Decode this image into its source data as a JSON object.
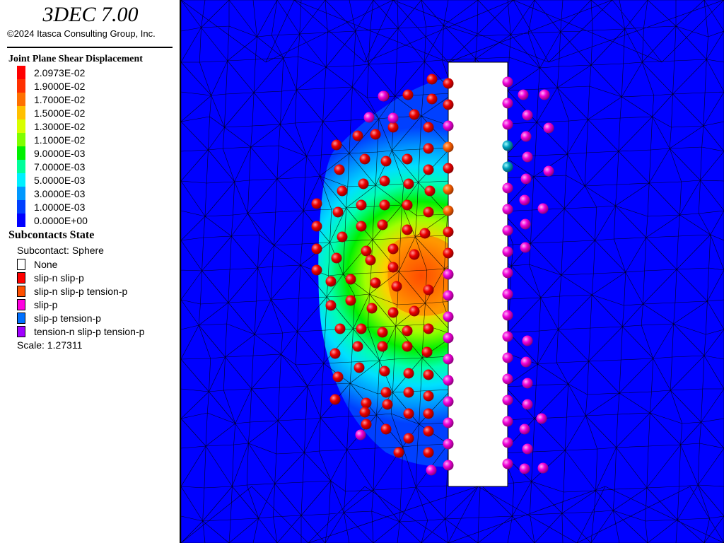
{
  "app": {
    "title": "3DEC 7.00",
    "copyright": "©2024 Itasca Consulting Group, Inc."
  },
  "legend": {
    "shear": {
      "heading": "Joint Plane Shear Displacement",
      "levels": [
        {
          "label": "2.0973E-02",
          "color": "#ff0000"
        },
        {
          "label": "1.9000E-02",
          "color": "#ff3000"
        },
        {
          "label": "1.7000E-02",
          "color": "#ff7000"
        },
        {
          "label": "1.5000E-02",
          "color": "#ffc000"
        },
        {
          "label": "1.3000E-02",
          "color": "#d8ff00"
        },
        {
          "label": "1.1000E-02",
          "color": "#80ff00"
        },
        {
          "label": "9.0000E-03",
          "color": "#00f000"
        },
        {
          "label": "7.0000E-03",
          "color": "#00ff9a"
        },
        {
          "label": "5.0000E-03",
          "color": "#00f0ff"
        },
        {
          "label": "3.0000E-03",
          "color": "#0098ff"
        },
        {
          "label": "1.0000E-03",
          "color": "#0040ff"
        },
        {
          "label": "0.0000E+00",
          "color": "#0000ff"
        }
      ]
    },
    "subcontacts": {
      "heading": "Subcontacts State",
      "subtitle": "Subcontact: Sphere",
      "states": [
        {
          "label": "None",
          "color": "#ffffff"
        },
        {
          "label": "slip-n slip-p",
          "color": "#ff0000"
        },
        {
          "label": "slip-n slip-p tension-p",
          "color": "#ff5000"
        },
        {
          "label": "slip-p",
          "color": "#ff00e0"
        },
        {
          "label": "slip-p tension-p",
          "color": "#0070ff"
        },
        {
          "label": "tension-n slip-p tension-p",
          "color": "#a000ff"
        }
      ],
      "scale": "Scale: 1.27311"
    }
  },
  "colors": {
    "background": "#0000ff",
    "opening": "#ffffff",
    "mesh": "#000000",
    "sphere_slip_n_slip_p": "#ff0000",
    "sphere_slip_p": "#ff00e0",
    "sphere_tension": "#00a0c0",
    "sphere_orange": "#ff6000"
  }
}
